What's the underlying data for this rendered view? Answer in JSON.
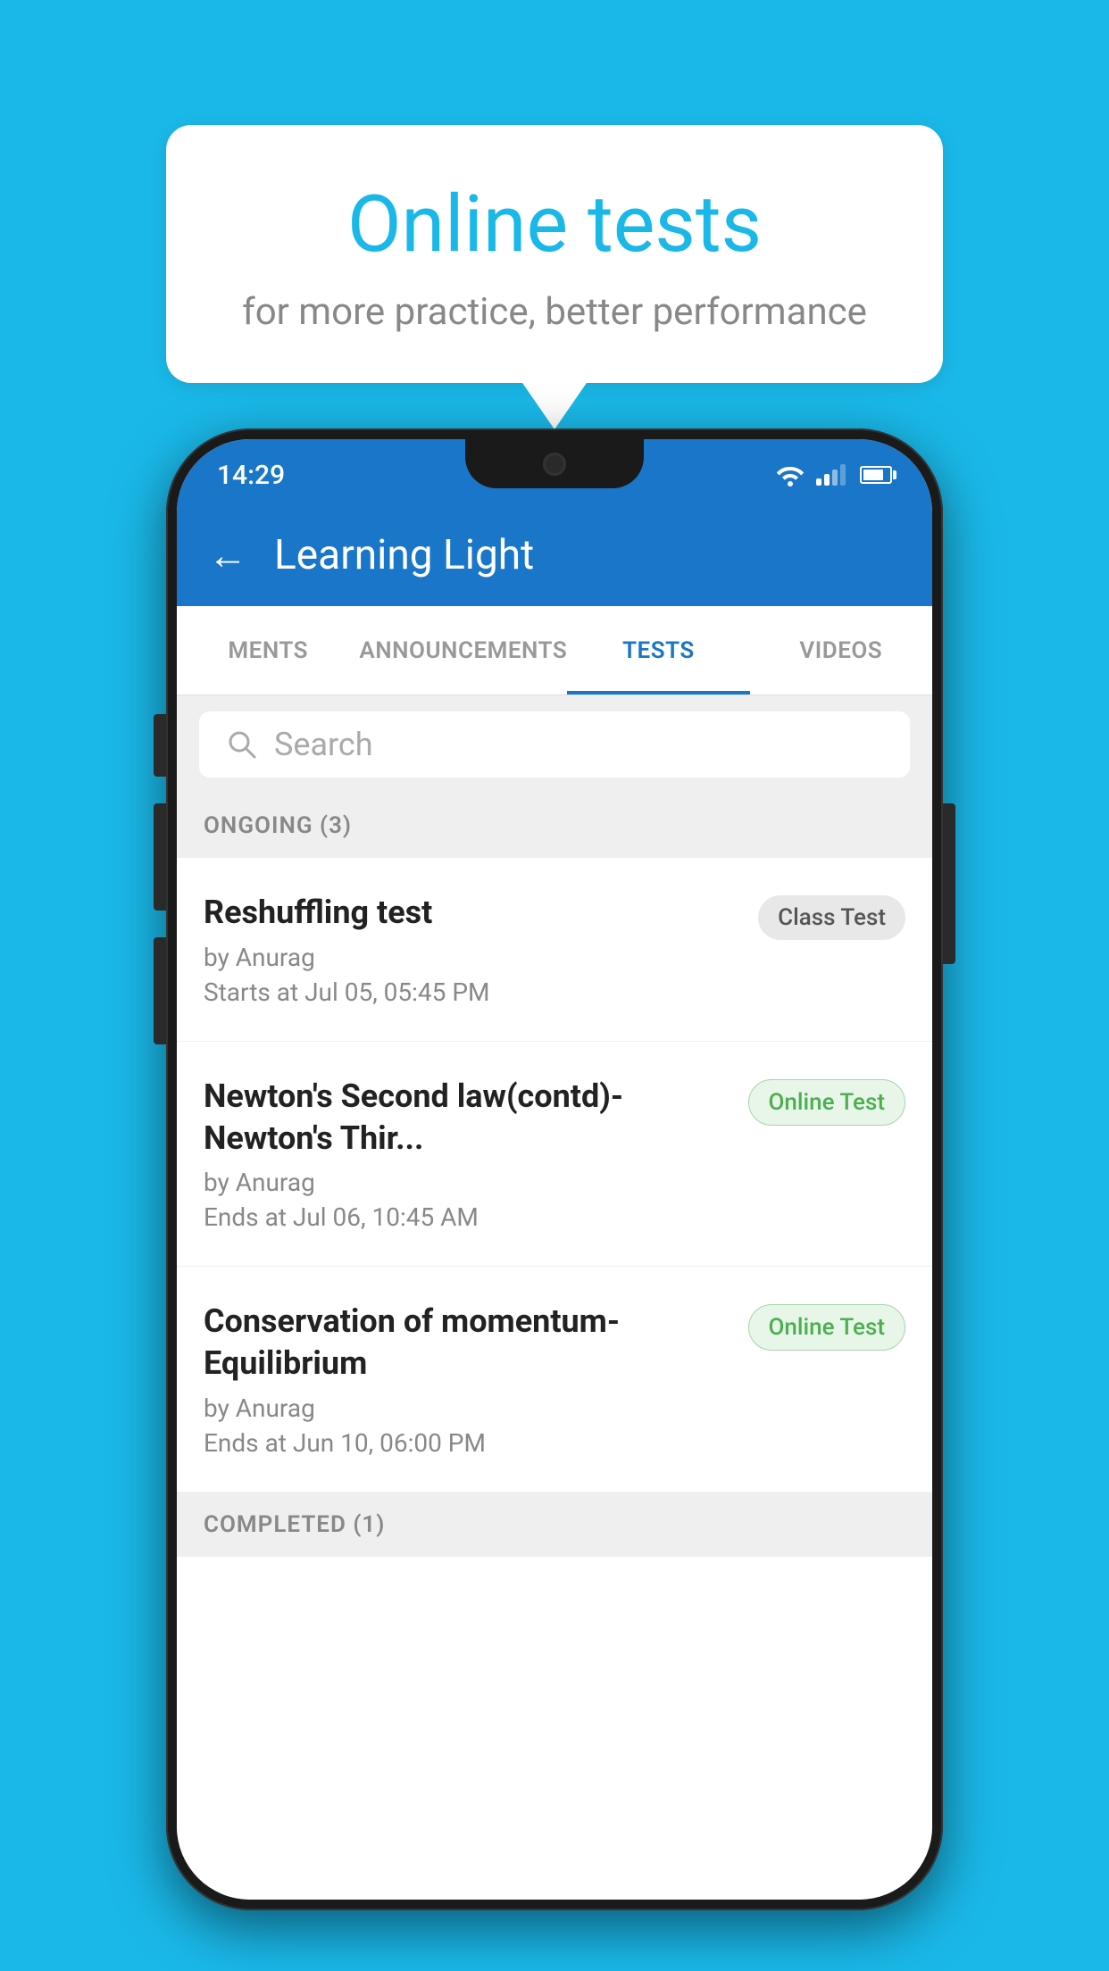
{
  "background": {
    "color": "#1ab8e8"
  },
  "bubble": {
    "title": "Online tests",
    "subtitle": "for more practice, better performance"
  },
  "phone": {
    "statusBar": {
      "time": "14:29"
    },
    "header": {
      "title": "Learning Light",
      "backLabel": "←"
    },
    "tabs": [
      {
        "label": "MENTS",
        "active": false
      },
      {
        "label": "ANNOUNCEMENTS",
        "active": false
      },
      {
        "label": "TESTS",
        "active": true
      },
      {
        "label": "VIDEOS",
        "active": false
      }
    ],
    "search": {
      "placeholder": "Search"
    },
    "sections": [
      {
        "label": "ONGOING (3)",
        "tests": [
          {
            "name": "Reshuffling test",
            "author": "by Anurag",
            "time": "Starts at  Jul 05, 05:45 PM",
            "badge": "Class Test",
            "badgeType": "class"
          },
          {
            "name": "Newton's Second law(contd)-Newton's Thir...",
            "author": "by Anurag",
            "time": "Ends at  Jul 06, 10:45 AM",
            "badge": "Online Test",
            "badgeType": "online"
          },
          {
            "name": "Conservation of momentum-Equilibrium",
            "author": "by Anurag",
            "time": "Ends at  Jun 10, 06:00 PM",
            "badge": "Online Test",
            "badgeType": "online"
          }
        ]
      },
      {
        "label": "COMPLETED (1)"
      }
    ]
  }
}
